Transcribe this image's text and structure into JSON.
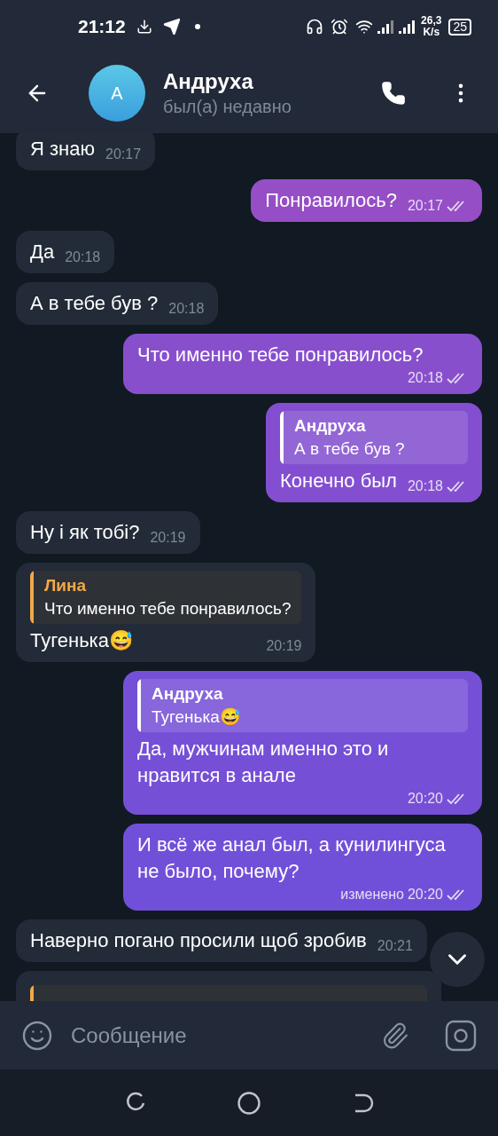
{
  "status_bar": {
    "time": "21:12",
    "speed": "26,3",
    "speed_unit": "K/s",
    "battery": "25"
  },
  "header": {
    "avatar_letter": "A",
    "name": "Андруха",
    "status": "был(а) недавно"
  },
  "messages": [
    {
      "kind": "message",
      "outgoing": false,
      "text": "Я знаю",
      "time": "20:17"
    },
    {
      "kind": "message",
      "outgoing": true,
      "text": "Понравилось?",
      "time": "20:17",
      "read": true
    },
    {
      "kind": "message",
      "outgoing": false,
      "text": "Да",
      "time": "20:18"
    },
    {
      "kind": "message",
      "outgoing": false,
      "text": "А в тебе був ?",
      "time": "20:18"
    },
    {
      "kind": "message",
      "outgoing": true,
      "text": "Что именно тебе понравилось?",
      "time": "20:18",
      "read": true
    },
    {
      "kind": "message",
      "outgoing": true,
      "reply": {
        "name": "Андруха",
        "text": "А в тебе був ?"
      },
      "text": "Конечно был",
      "time": "20:18",
      "read": true
    },
    {
      "kind": "message",
      "outgoing": false,
      "text": "Ну і як тобі?",
      "time": "20:19"
    },
    {
      "kind": "message",
      "outgoing": false,
      "reply": {
        "name": "Лина",
        "text": "Что именно тебе понравилось?"
      },
      "text": "Тугенька😅",
      "time": "20:19"
    },
    {
      "kind": "message",
      "outgoing": true,
      "reply": {
        "name": "Андруха",
        "text": "Тугенька😅"
      },
      "text": "Да, мужчинам именно это и нравится в анале",
      "time": "20:20",
      "read": true
    },
    {
      "kind": "message",
      "outgoing": true,
      "text": "И всё же анал был, а кунилингуса не было, почему?",
      "edited_label": "изменено",
      "time": "20:20",
      "read": true
    },
    {
      "kind": "message",
      "outgoing": false,
      "text": "Наверно погано просили щоб зробив",
      "time": "20:21"
    },
    {
      "kind": "partial",
      "outgoing": false
    }
  ],
  "composer": {
    "placeholder": "Сообщение"
  }
}
